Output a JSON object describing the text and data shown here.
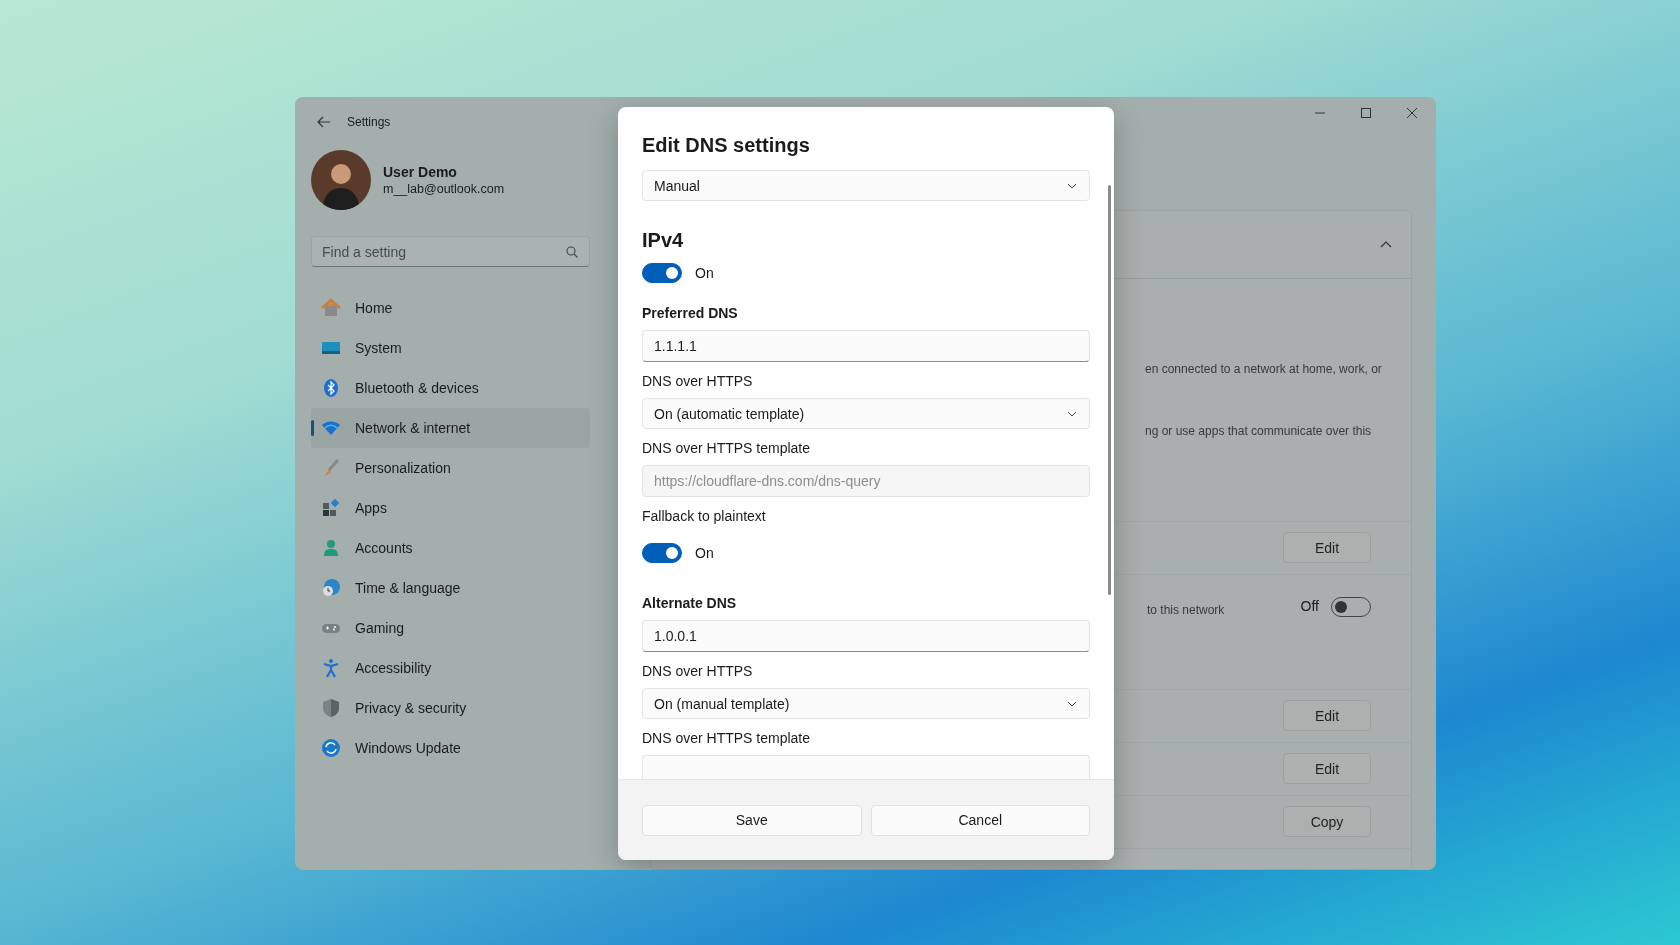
{
  "window": {
    "title": "Settings"
  },
  "profile": {
    "name": "User Demo",
    "email": "m__lab@outlook.com"
  },
  "search": {
    "placeholder": "Find a setting"
  },
  "nav": [
    {
      "label": "Home",
      "selected": false
    },
    {
      "label": "System",
      "selected": false
    },
    {
      "label": "Bluetooth & devices",
      "selected": false
    },
    {
      "label": "Network & internet",
      "selected": true
    },
    {
      "label": "Personalization",
      "selected": false
    },
    {
      "label": "Apps",
      "selected": false
    },
    {
      "label": "Accounts",
      "selected": false
    },
    {
      "label": "Time & language",
      "selected": false
    },
    {
      "label": "Gaming",
      "selected": false
    },
    {
      "label": "Accessibility",
      "selected": false
    },
    {
      "label": "Privacy & security",
      "selected": false
    },
    {
      "label": "Windows Update",
      "selected": false
    }
  ],
  "background_card": {
    "expanded": true,
    "rows": [
      {
        "kind": "text",
        "lines": [
          "en connected to a network at home, work, or",
          "ng or use apps that communicate over this"
        ]
      },
      {
        "kind": "button",
        "label": "Edit"
      },
      {
        "kind": "toggle",
        "label": "Off",
        "on": false,
        "text": "to this network"
      },
      {
        "kind": "button",
        "label": "Edit"
      },
      {
        "kind": "button",
        "label": "Edit"
      },
      {
        "kind": "button",
        "label": "Copy"
      }
    ]
  },
  "dialog": {
    "title": "Edit DNS settings",
    "mode": "Manual",
    "items": [
      {
        "kind": "heading",
        "text": "IPv4"
      },
      {
        "kind": "toggle",
        "label": "On",
        "on": true
      },
      {
        "kind": "subheading",
        "text": "Preferred DNS"
      },
      {
        "kind": "field",
        "value": "1.1.1.1"
      },
      {
        "kind": "label",
        "text": "DNS over HTTPS"
      },
      {
        "kind": "select",
        "value": "On (automatic template)"
      },
      {
        "kind": "label",
        "text": "DNS over HTTPS template"
      },
      {
        "kind": "field",
        "placeholder": "https://cloudflare-dns.com/dns-query",
        "disabled": true
      },
      {
        "kind": "label",
        "text": "Fallback to plaintext"
      },
      {
        "kind": "toggle",
        "label": "On",
        "on": true
      },
      {
        "kind": "subheading",
        "text": "Alternate DNS"
      },
      {
        "kind": "field",
        "value": "1.0.0.1"
      },
      {
        "kind": "label",
        "text": "DNS over HTTPS"
      },
      {
        "kind": "select",
        "value": "On (manual template)"
      },
      {
        "kind": "label",
        "text": "DNS over HTTPS template"
      },
      {
        "kind": "field",
        "value": ""
      }
    ],
    "buttons": [
      "Save",
      "Cancel"
    ]
  }
}
